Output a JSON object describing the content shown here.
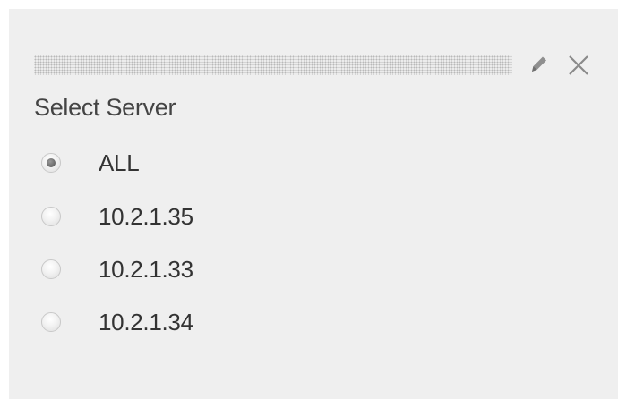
{
  "widget": {
    "title": "Select Server",
    "icons": {
      "edit": "pencil-icon",
      "close": "close-icon"
    },
    "selected": "ALL",
    "options": [
      {
        "label": "ALL",
        "checked": true
      },
      {
        "label": "10.2.1.35",
        "checked": false
      },
      {
        "label": "10.2.1.33",
        "checked": false
      },
      {
        "label": "10.2.1.34",
        "checked": false
      }
    ]
  }
}
